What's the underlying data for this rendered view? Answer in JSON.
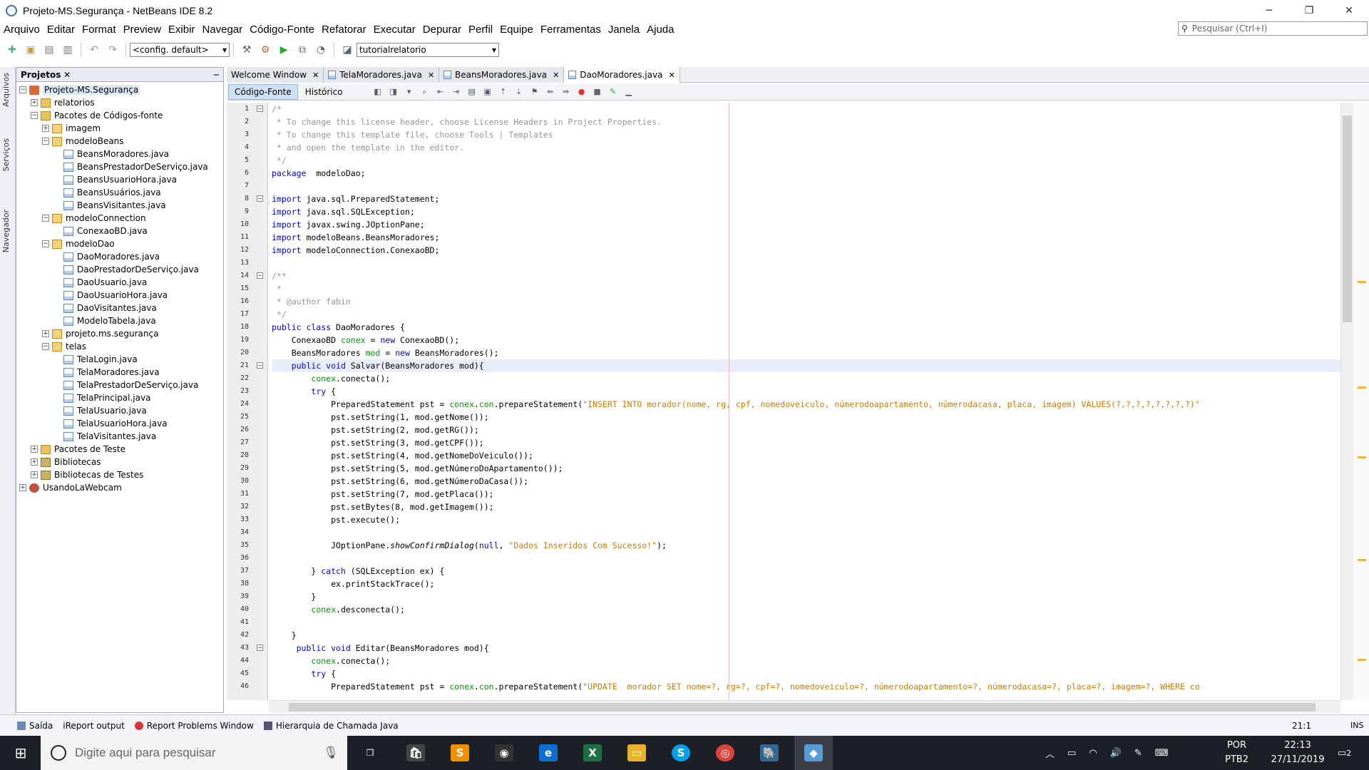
{
  "window": {
    "title": "Projeto-MS.Segurança - NetBeans IDE 8.2",
    "minimize": "─",
    "restore": "❐",
    "close": "✕"
  },
  "menu": [
    "Arquivo",
    "Editar",
    "Format",
    "Preview",
    "Exibir",
    "Navegar",
    "Código-Fonte",
    "Refatorar",
    "Executar",
    "Depurar",
    "Perfil",
    "Equipe",
    "Ferramentas",
    "Janela",
    "Ajuda"
  ],
  "search": {
    "placeholder": "Pesquisar (Ctrl+I)"
  },
  "toolbar": {
    "config": "<config. default>",
    "run_target": "tutorialrelatorio"
  },
  "side_tabs": [
    "Arquivos",
    "Serviços",
    "Navegador"
  ],
  "projects": {
    "title": "Projetos",
    "close": "✕",
    "minimize": "─",
    "tree": [
      {
        "label": "Projeto-MS.Segurança",
        "depth": 0,
        "exp": "−",
        "icon": "proj"
      },
      {
        "label": "relatorios",
        "depth": 1,
        "exp": "+",
        "icon": "folder"
      },
      {
        "label": "Pacotes de Códigos-fonte",
        "depth": 1,
        "exp": "−",
        "icon": "folder"
      },
      {
        "label": "imagem",
        "depth": 2,
        "exp": "+",
        "icon": "pkg"
      },
      {
        "label": "modeloBeans",
        "depth": 2,
        "exp": "−",
        "icon": "pkg"
      },
      {
        "label": "BeansMoradores.java",
        "depth": 3,
        "exp": "",
        "icon": "java"
      },
      {
        "label": "BeansPrestadorDeServiço.java",
        "depth": 3,
        "exp": "",
        "icon": "java"
      },
      {
        "label": "BeansUsuarioHora.java",
        "depth": 3,
        "exp": "",
        "icon": "java"
      },
      {
        "label": "BeansUsuários.java",
        "depth": 3,
        "exp": "",
        "icon": "java"
      },
      {
        "label": "BeansVisitantes.java",
        "depth": 3,
        "exp": "",
        "icon": "java"
      },
      {
        "label": "modeloConnection",
        "depth": 2,
        "exp": "−",
        "icon": "pkg"
      },
      {
        "label": "ConexaoBD.java",
        "depth": 3,
        "exp": "",
        "icon": "java"
      },
      {
        "label": "modeloDao",
        "depth": 2,
        "exp": "−",
        "icon": "pkg"
      },
      {
        "label": "DaoMoradores.java",
        "depth": 3,
        "exp": "",
        "icon": "java"
      },
      {
        "label": "DaoPrestadorDeServiço.java",
        "depth": 3,
        "exp": "",
        "icon": "java"
      },
      {
        "label": "DaoUsuario.java",
        "depth": 3,
        "exp": "",
        "icon": "java"
      },
      {
        "label": "DaoUsuarioHora.java",
        "depth": 3,
        "exp": "",
        "icon": "java"
      },
      {
        "label": "DaoVisitantes.java",
        "depth": 3,
        "exp": "",
        "icon": "java"
      },
      {
        "label": "ModeloTabela.java",
        "depth": 3,
        "exp": "",
        "icon": "java"
      },
      {
        "label": "projeto.ms.segurança",
        "depth": 2,
        "exp": "+",
        "icon": "pkg"
      },
      {
        "label": "telas",
        "depth": 2,
        "exp": "−",
        "icon": "pkg"
      },
      {
        "label": "TelaLogin.java",
        "depth": 3,
        "exp": "",
        "icon": "java"
      },
      {
        "label": "TelaMoradores.java",
        "depth": 3,
        "exp": "",
        "icon": "java"
      },
      {
        "label": "TelaPrestadorDeServiço.java",
        "depth": 3,
        "exp": "",
        "icon": "java"
      },
      {
        "label": "TelaPrincipal.java",
        "depth": 3,
        "exp": "",
        "icon": "java"
      },
      {
        "label": "TelaUsuario.java",
        "depth": 3,
        "exp": "",
        "icon": "java"
      },
      {
        "label": "TelaUsuarioHora.java",
        "depth": 3,
        "exp": "",
        "icon": "java"
      },
      {
        "label": "TelaVisitantes.java",
        "depth": 3,
        "exp": "",
        "icon": "java"
      },
      {
        "label": "Pacotes de Teste",
        "depth": 1,
        "exp": "+",
        "icon": "folder"
      },
      {
        "label": "Bibliotecas",
        "depth": 1,
        "exp": "+",
        "icon": "lib"
      },
      {
        "label": "Bibliotecas de Testes",
        "depth": 1,
        "exp": "+",
        "icon": "lib"
      },
      {
        "label": "UsandoLaWebcam",
        "depth": 0,
        "exp": "+",
        "icon": "web"
      }
    ]
  },
  "editor_tabs": [
    {
      "label": "Welcome Window",
      "active": false
    },
    {
      "label": "TelaMoradores.java",
      "active": false
    },
    {
      "label": "BeansMoradores.java",
      "active": false
    },
    {
      "label": "DaoMoradores.java",
      "active": true
    }
  ],
  "sub_tabs": [
    "Código-Fonte",
    "Histórico"
  ],
  "code_lines": [
    [
      [
        "cm",
        "/*"
      ]
    ],
    [
      [
        "cm",
        " * To change this license header, choose License Headers in Project Properties."
      ]
    ],
    [
      [
        "cm",
        " * To change this template file, choose Tools | Templates"
      ]
    ],
    [
      [
        "cm",
        " * and open the template in the editor."
      ]
    ],
    [
      [
        "cm",
        " */"
      ]
    ],
    [
      [
        "kw",
        "package"
      ],
      [
        "",
        "  modeloDao;"
      ]
    ],
    [],
    [
      [
        "kw",
        "import"
      ],
      [
        "",
        " java.sql.PreparedStatement;"
      ]
    ],
    [
      [
        "kw",
        "import"
      ],
      [
        "",
        " java.sql.SQLException;"
      ]
    ],
    [
      [
        "kw",
        "import"
      ],
      [
        "",
        " javax.swing.JOptionPane;"
      ]
    ],
    [
      [
        "kw",
        "import"
      ],
      [
        "",
        " modeloBeans.BeansMoradores;"
      ]
    ],
    [
      [
        "kw",
        "import"
      ],
      [
        "",
        " modeloConnection.ConexaoBD;"
      ]
    ],
    [],
    [
      [
        "cm",
        "/**"
      ]
    ],
    [
      [
        "cm",
        " *"
      ]
    ],
    [
      [
        "cm",
        " * @author fabin"
      ]
    ],
    [
      [
        "cm",
        " */"
      ]
    ],
    [
      [
        "kw",
        "public class"
      ],
      [
        "",
        " DaoMoradores {"
      ]
    ],
    [
      [
        "",
        "    ConexaoBD "
      ],
      [
        "fd",
        "conex"
      ],
      [
        "",
        " = "
      ],
      [
        "kw",
        "new"
      ],
      [
        "",
        " ConexaoBD();"
      ]
    ],
    [
      [
        "",
        "    BeansMoradores "
      ],
      [
        "fd",
        "mod"
      ],
      [
        "",
        " = "
      ],
      [
        "kw",
        "new"
      ],
      [
        "",
        " BeansMoradores();"
      ]
    ],
    [
      [
        "",
        "    "
      ],
      [
        "kw",
        "public void"
      ],
      [
        "",
        " Salvar(BeansMoradores mod){"
      ]
    ],
    [
      [
        "",
        "        "
      ],
      [
        "fd",
        "conex"
      ],
      [
        "",
        ".conecta();"
      ]
    ],
    [
      [
        "",
        "        "
      ],
      [
        "kw",
        "try"
      ],
      [
        "",
        " {"
      ]
    ],
    [
      [
        "",
        "            PreparedStatement pst = "
      ],
      [
        "fd",
        "conex"
      ],
      [
        "",
        "."
      ],
      [
        "fd",
        "con"
      ],
      [
        "",
        ".prepareStatement("
      ],
      [
        "st",
        "\"INSERT INTO morador(nome, rg, cpf, nomedoveiculo, númerodoapartamento, númerodacasa, placa, imagem) VALUES(?,?,?,?,?,?,?,?)\""
      ]
    ],
    [
      [
        "",
        "            pst.setString(1, mod.getNome());"
      ]
    ],
    [
      [
        "",
        "            pst.setString(2, mod.getRG());"
      ]
    ],
    [
      [
        "",
        "            pst.setString(3, mod.getCPF());"
      ]
    ],
    [
      [
        "",
        "            pst.setString(4, mod.getNomeDoVeiculo());"
      ]
    ],
    [
      [
        "",
        "            pst.setString(5, mod.getNúmeroDoApartamento());"
      ]
    ],
    [
      [
        "",
        "            pst.setString(6, mod.getNúmeroDaCasa());"
      ]
    ],
    [
      [
        "",
        "            pst.setString(7, mod.getPlaca());"
      ]
    ],
    [
      [
        "",
        "            pst.setBytes(8, mod.getImagem());"
      ]
    ],
    [
      [
        "",
        "            pst.execute();"
      ]
    ],
    [],
    [
      [
        "",
        "            JOptionPane."
      ],
      [
        "it",
        "showConfirmDialog"
      ],
      [
        "",
        "("
      ],
      [
        "kw",
        "null"
      ],
      [
        "",
        ", "
      ],
      [
        "st",
        "\"Dados Inseridos Com Sucesso!\""
      ],
      [
        "",
        ");"
      ]
    ],
    [],
    [
      [
        "",
        "        } "
      ],
      [
        "kw",
        "catch"
      ],
      [
        "",
        " (SQLException ex) {"
      ]
    ],
    [
      [
        "",
        "            ex.printStackTrace();"
      ]
    ],
    [
      [
        "",
        "        }"
      ]
    ],
    [
      [
        "",
        "        "
      ],
      [
        "fd",
        "conex"
      ],
      [
        "",
        ".desconecta();"
      ]
    ],
    [],
    [
      [
        "",
        "    }"
      ]
    ],
    [
      [
        "",
        "     "
      ],
      [
        "kw",
        "public void"
      ],
      [
        "",
        " Editar(BeansMoradores mod){"
      ]
    ],
    [
      [
        "",
        "        "
      ],
      [
        "fd",
        "conex"
      ],
      [
        "",
        ".conecta();"
      ]
    ],
    [
      [
        "",
        "        "
      ],
      [
        "kw",
        "try"
      ],
      [
        "",
        " {"
      ]
    ],
    [
      [
        "",
        "            PreparedStatement pst = "
      ],
      [
        "fd",
        "conex"
      ],
      [
        "",
        "."
      ],
      [
        "fd",
        "con"
      ],
      [
        "",
        ".prepareStatement("
      ],
      [
        "st",
        "\"UPDATE  morador SET nome=?, rg=?, cpf=?, nomedoveiculo=?, númerodoapartamento=?, númerodacasa=?, placa=?, imagem=?, WHERE co"
      ]
    ]
  ],
  "line_numbers": [
    "1",
    "2",
    "3",
    "4",
    "5",
    "6",
    "7",
    "8",
    "9",
    "10",
    "11",
    "12",
    "13",
    "14",
    "15",
    "16",
    "17",
    "18",
    "19",
    "20",
    "21",
    "22",
    "23",
    "24",
    "25",
    "26",
    "27",
    "28",
    "29",
    "30",
    "31",
    "32",
    "33",
    "34",
    "35",
    "36",
    "37",
    "38",
    "39",
    "40",
    "41",
    "42",
    "43",
    "44",
    "45",
    "46"
  ],
  "status": {
    "items": [
      "Saída",
      "iReport output",
      "Report Problems Window",
      "Hierarquia de Chamada Java"
    ],
    "position": "21:1",
    "mode": "INS"
  },
  "taskbar": {
    "search_placeholder": "Digite aqui para pesquisar",
    "lang_top": "POR",
    "lang_bottom": "PTB2",
    "time": "22:13",
    "date": "27/11/2019",
    "notifications": "2"
  }
}
